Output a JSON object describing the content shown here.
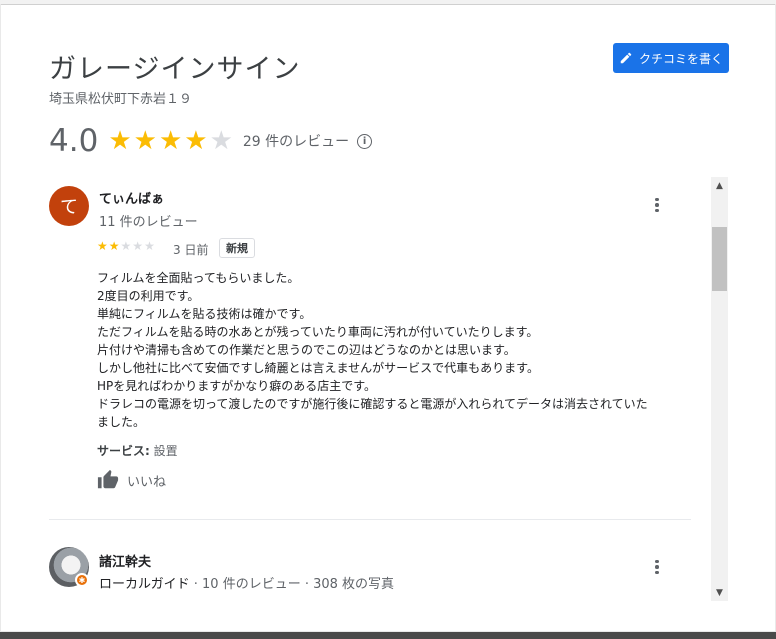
{
  "place": {
    "name": "ガレージインサイン",
    "address": "埼玉県松伏町下赤岩１９",
    "rating": "4.0",
    "stars_filled": 4,
    "review_count_text": "29 件のレビュー"
  },
  "write_review_label": "クチコミを書く",
  "reviews": [
    {
      "avatar_letter": "て",
      "author": "てぃんばぁ",
      "author_meta": "11 件のレビュー",
      "stars_filled": 2,
      "date": "3 日前",
      "badge": "新規",
      "text_lines": [
        "フィルムを全面貼ってもらいました。",
        "2度目の利用です。",
        "単純にフィルムを貼る技術は確かです。",
        "ただフィルムを貼る時の水あとが残っていたり車両に汚れが付いていたりします。",
        "片付けや清掃も含めての作業だと思うのでこの辺はどうなのかとは思います。",
        "しかし他社に比べて安価ですし綺麗とは言えませんがサービスで代車もあります。",
        "HPを見ればわかりますがかなり癖のある店主です。",
        "ドラレコの電源を切って渡したのですが施行後に確認すると電源が入れられてデータは消去されていた",
        "ました。"
      ],
      "service_label": "サービス:",
      "service_value": "設置",
      "like_label": "いいね"
    },
    {
      "author": "諸江幹夫",
      "guide_label": "ローカルガイド",
      "author_meta": " · 10 件のレビュー · 308 枚の写真"
    }
  ],
  "colors": {
    "accent": "#1a73e8",
    "star": "#fbbc04",
    "avatar": "#c2410c"
  }
}
